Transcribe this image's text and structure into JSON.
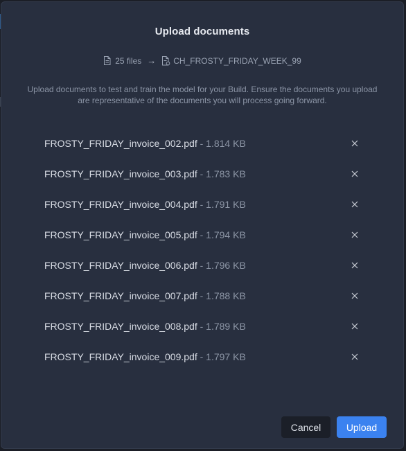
{
  "dialog": {
    "title": "Upload documents",
    "file_count": "25 files",
    "arrow": "→",
    "destination": "CH_FROSTY_FRIDAY_WEEK_99",
    "description": "Upload documents to test and train the model for your Build. Ensure the documents you upload are representative of the documents you will process going forward."
  },
  "files": [
    {
      "name": "FROSTY_FRIDAY_invoice_002.pdf",
      "size": " - 1.814 KB"
    },
    {
      "name": "FROSTY_FRIDAY_invoice_003.pdf",
      "size": " - 1.783 KB"
    },
    {
      "name": "FROSTY_FRIDAY_invoice_004.pdf",
      "size": " - 1.791 KB"
    },
    {
      "name": "FROSTY_FRIDAY_invoice_005.pdf",
      "size": " - 1.794 KB"
    },
    {
      "name": "FROSTY_FRIDAY_invoice_006.pdf",
      "size": " - 1.796 KB"
    },
    {
      "name": "FROSTY_FRIDAY_invoice_007.pdf",
      "size": " - 1.788 KB"
    },
    {
      "name": "FROSTY_FRIDAY_invoice_008.pdf",
      "size": " - 1.789 KB"
    },
    {
      "name": "FROSTY_FRIDAY_invoice_009.pdf",
      "size": " - 1.797 KB"
    }
  ],
  "actions": {
    "cancel_label": "Cancel",
    "upload_label": "Upload"
  },
  "icons": {
    "file": "file-icon",
    "arrow": "arrow-right-icon",
    "destination": "document-build-icon",
    "remove": "close-icon"
  },
  "colors": {
    "modal_bg": "#282f3f",
    "primary": "#3b82f0",
    "text": "#d9dde5",
    "muted": "#8d96a6"
  }
}
